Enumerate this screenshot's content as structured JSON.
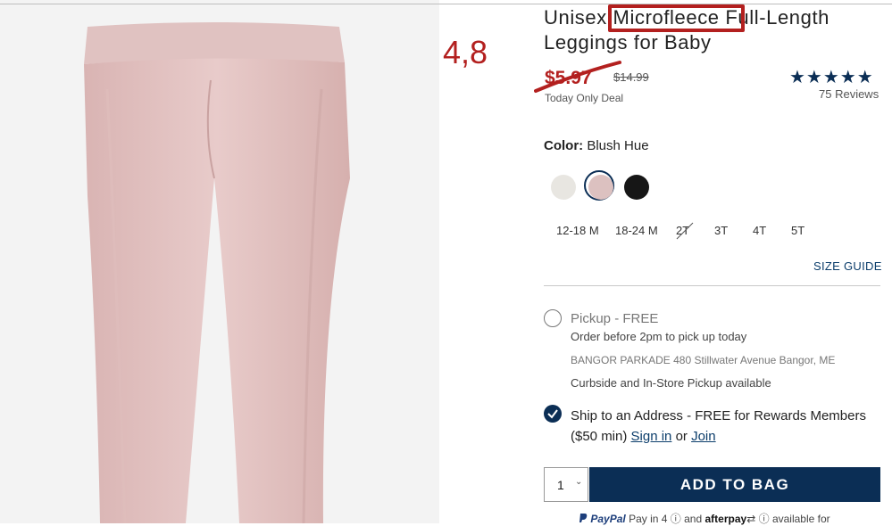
{
  "annotation": {
    "handwritten_note": "4,8",
    "accent": "#b3201f"
  },
  "product": {
    "title": "Unisex Microfleece Full-Length Leggings for Baby",
    "highlighted_word": "Microfleece",
    "sale_price": "$5.97",
    "original_price": "$14.99",
    "deal_text": "Today Only Deal",
    "rating": 5,
    "stars": "★★★★★",
    "reviews": "75 Reviews"
  },
  "color": {
    "label": "Color:",
    "selected": "Blush Hue",
    "swatches": [
      {
        "name": "cream",
        "hex": "#e8e6e1"
      },
      {
        "name": "blush-hue",
        "hex": "#dcc1c0",
        "selected": true
      },
      {
        "name": "black",
        "hex": "#161616"
      }
    ]
  },
  "sizes": [
    {
      "label": "12-18 M",
      "available": true
    },
    {
      "label": "18-24 M",
      "available": true
    },
    {
      "label": "2T",
      "available": false
    },
    {
      "label": "3T",
      "available": true
    },
    {
      "label": "4T",
      "available": true
    },
    {
      "label": "5T",
      "available": true
    }
  ],
  "size_guide": "SIZE GUIDE",
  "fulfillment": {
    "pickup_title": "Pickup - FREE",
    "pickup_sub": "Order before 2pm to pick up today",
    "pickup_store": "BANGOR PARKADE 480 Stillwater Avenue Bangor, ME",
    "pickup_curbside": "Curbside and In-Store Pickup available",
    "ship_text": "Ship to an Address - FREE for Rewards Members ($50 min)",
    "sign_in": "Sign in",
    "or": "or",
    "join": "Join"
  },
  "cart": {
    "quantity": "1",
    "add_to_bag": "ADD TO BAG"
  },
  "payment": {
    "paypal": "PayPal",
    "pay_in": "Pay in 4",
    "and": "and",
    "afterpay": "afterpay",
    "available_for": "available for"
  },
  "colors": {
    "navy": "#0b2e55",
    "sale_red": "#b3201f"
  }
}
